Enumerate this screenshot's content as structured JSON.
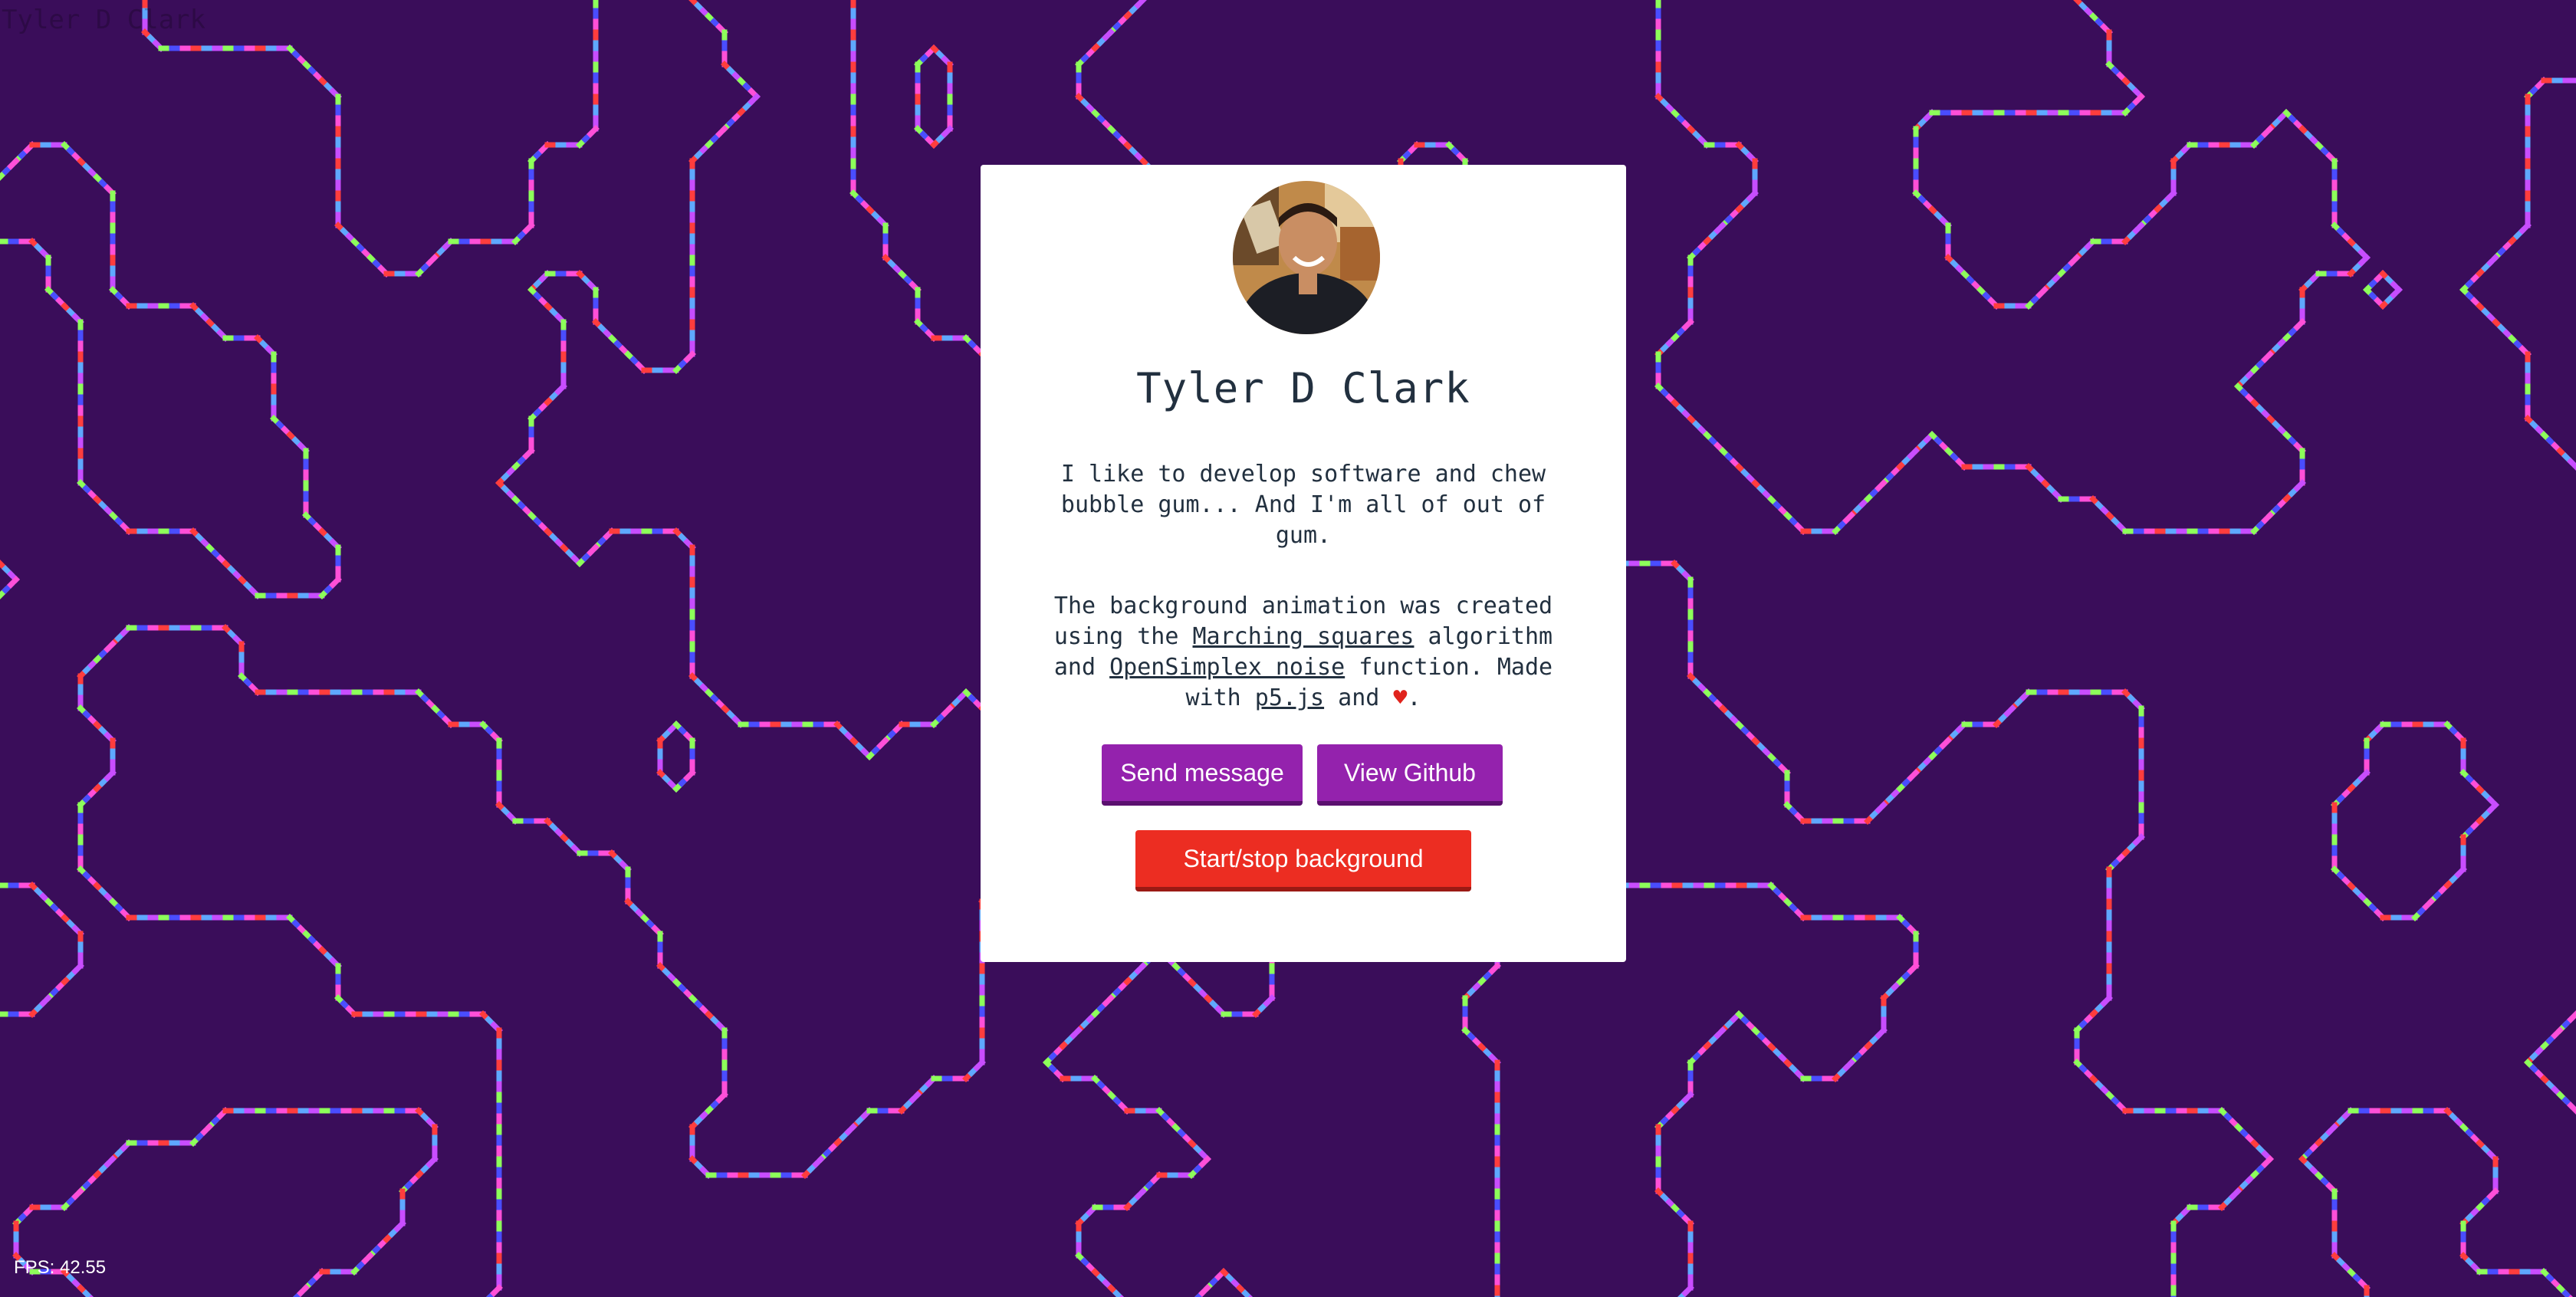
{
  "page": {
    "corner_title": "Tyler D Clark",
    "fps_label": "FPS: 42.55"
  },
  "profile": {
    "name": "Tyler D Clark",
    "bio_line": "I like to develop software and chew bubble gum... And I'm all of out of gum.",
    "about_prefix": "The background animation was created using the ",
    "link_marching": "Marching squares",
    "about_mid1": " algorithm and ",
    "link_noise": "OpenSimplex noise",
    "about_mid2": " function. Made with ",
    "link_p5": "p5.js",
    "about_and": " and ",
    "heart": "♥",
    "about_end": "."
  },
  "buttons": {
    "send_message": "Send message",
    "view_github": "View Github",
    "toggle_background": "Start/stop background"
  },
  "colors": {
    "background": "#3a0d5a",
    "card": "#ffffff",
    "text": "#22303f",
    "button_purple": "#9422ad",
    "button_red": "#ec2d22",
    "line_palette": [
      "#ff3d3d",
      "#ff4fd8",
      "#5fa8ff",
      "#8dff5a",
      "#c84dff",
      "#4a4dff"
    ]
  },
  "icons": {
    "avatar": "profile-photo",
    "heart": "heart-icon"
  }
}
